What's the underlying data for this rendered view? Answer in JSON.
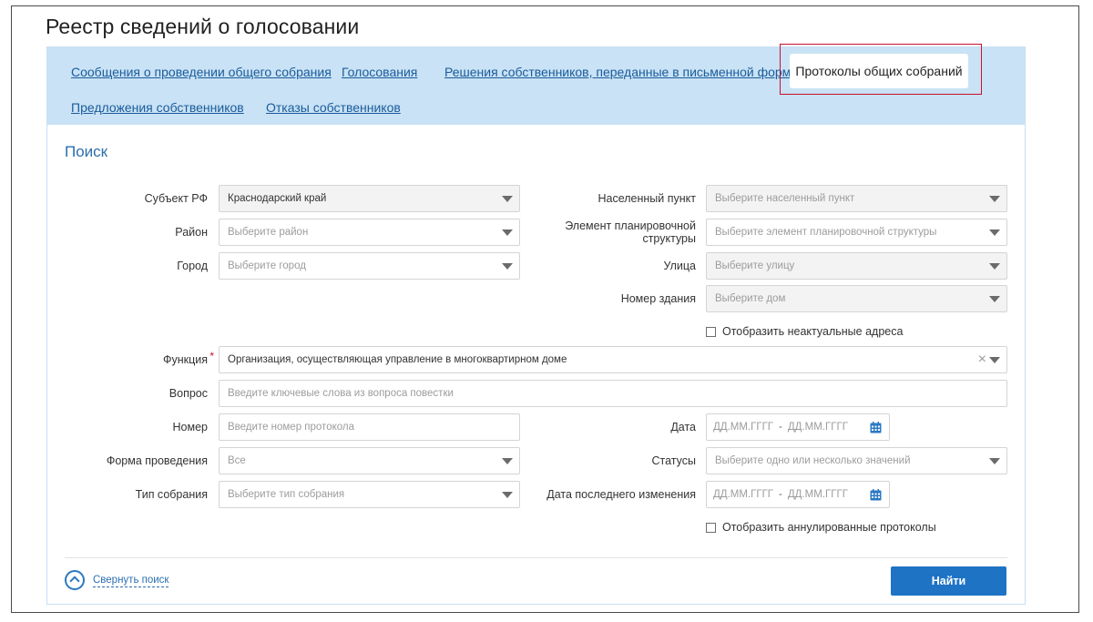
{
  "page_title": "Реестр сведений о голосовании",
  "tabs": [
    {
      "label": "Сообщения о проведении общего собрания"
    },
    {
      "label": "Голосования"
    },
    {
      "label": "Решения собственников, переданные в письменной форме"
    },
    {
      "label": "Протоколы общих собраний",
      "active": true
    },
    {
      "label": "Предложения собственников"
    },
    {
      "label": "Отказы собственников"
    }
  ],
  "search": {
    "title": "Поиск",
    "subject": {
      "label": "Субъект РФ",
      "value": "Краснодарский край"
    },
    "district": {
      "label": "Район",
      "placeholder": "Выберите район"
    },
    "city": {
      "label": "Город",
      "placeholder": "Выберите город"
    },
    "settlement": {
      "label": "Населенный пункт",
      "placeholder": "Выберите населенный пункт"
    },
    "planning_element": {
      "label_line1": "Элемент планировочной",
      "label_line2": "структуры",
      "placeholder": "Выберите элемент планировочной структуры"
    },
    "street": {
      "label": "Улица",
      "placeholder": "Выберите улицу"
    },
    "building": {
      "label": "Номер здания",
      "placeholder": "Выберите дом"
    },
    "show_inactive_addresses": {
      "label": "Отобразить неактуальные адреса",
      "checked": false
    },
    "function": {
      "label": "Функция",
      "value": "Организация, осуществляющая управление в многоквартирном доме"
    },
    "question": {
      "label": "Вопрос",
      "placeholder": "Введите ключевые слова из вопроса повестки"
    },
    "number": {
      "label": "Номер",
      "placeholder": "Введите номер протокола"
    },
    "date": {
      "label": "Дата",
      "from": "ДД.ММ.ГГГГ",
      "separator": "-",
      "to": "ДД.ММ.ГГГГ"
    },
    "form": {
      "label": "Форма проведения",
      "value": "Все"
    },
    "statuses": {
      "label": "Статусы",
      "placeholder": "Выберите одно или несколько значений"
    },
    "meeting_type": {
      "label": "Тип собрания",
      "placeholder": "Выберите тип собрания"
    },
    "last_change_date": {
      "label": "Дата последнего изменения",
      "from": "ДД.ММ.ГГГГ",
      "separator": "-",
      "to": "ДД.ММ.ГГГГ"
    },
    "show_annulled": {
      "label": "Отобразить аннулированные протоколы",
      "checked": false
    },
    "collapse_label": "Свернуть поиск",
    "find_button": "Найти"
  },
  "colors": {
    "tab_bar": "#c9e2f5",
    "link": "#1a5c9b",
    "accent": "#1e73c5",
    "highlight_border": "#c8102e"
  },
  "icons": {
    "caret": "chevron-down-icon",
    "clear": "clear-icon",
    "calendar": "calendar-icon",
    "collapse": "chevron-up-circle-icon"
  }
}
